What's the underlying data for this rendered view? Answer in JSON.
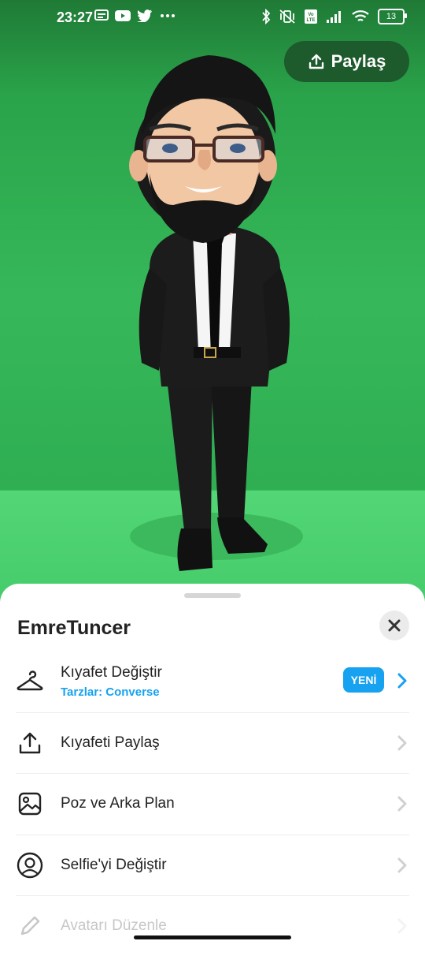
{
  "status_bar": {
    "time": "23:27",
    "battery": "13",
    "left_icons": [
      "message-icon",
      "youtube-icon",
      "twitter-icon",
      "more-dots-icon"
    ],
    "right_icons": [
      "bluetooth-icon",
      "vibrate-off-icon",
      "volte-icon",
      "signal-icon",
      "wifi-icon",
      "battery-icon"
    ]
  },
  "header": {
    "share_label": "Paylaş"
  },
  "sheet": {
    "title": "EmreTuncer",
    "items": [
      {
        "label": "Kıyafet Değiştir",
        "sub": "Tarzlar: Converse",
        "badge": "YENİ",
        "icon": "hanger-icon"
      },
      {
        "label": "Kıyafeti Paylaş",
        "icon": "upload-icon"
      },
      {
        "label": "Poz ve Arka Plan",
        "icon": "image-icon"
      },
      {
        "label": "Selfie'yi Değiştir",
        "icon": "user-circle-icon"
      },
      {
        "label": "Avatarı Düzenle",
        "icon": "pencil-icon"
      }
    ]
  },
  "colors": {
    "accent": "#16a2f0",
    "share_button": "#1d5a2c",
    "background_green": "#2aa34a"
  }
}
